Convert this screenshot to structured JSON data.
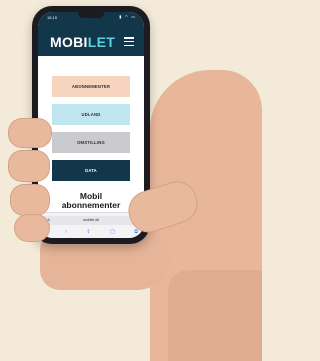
{
  "status_bar": {
    "time": "15.15",
    "icons": "▮ ◠ ▭"
  },
  "header": {
    "logo_mobi": "MOBI",
    "logo_let": "LET"
  },
  "nav_buttons": [
    {
      "label": "ABONNEMENTER"
    },
    {
      "label": "UDLAND"
    },
    {
      "label": "OMSTILLING"
    },
    {
      "label": "DATA"
    }
  ],
  "page_title": {
    "line1": "Mobil",
    "line2": "abonnementer"
  },
  "browser": {
    "text_size_label": "AA",
    "url": "mobilet.dk",
    "reload_icon": "↻",
    "toolbar": {
      "back": "‹",
      "forward": "›",
      "share": "⇪",
      "bookmarks": "▢",
      "tabs": "⧉"
    }
  },
  "colors": {
    "header_bg": "#12364a",
    "logo_accent": "#5fd0e4",
    "btn_abonnementer": "#f6d4be",
    "btn_udland": "#bfe6ef",
    "btn_omstilling": "#c9cbcf",
    "btn_data": "#12364a",
    "background": "#f3ead9"
  }
}
